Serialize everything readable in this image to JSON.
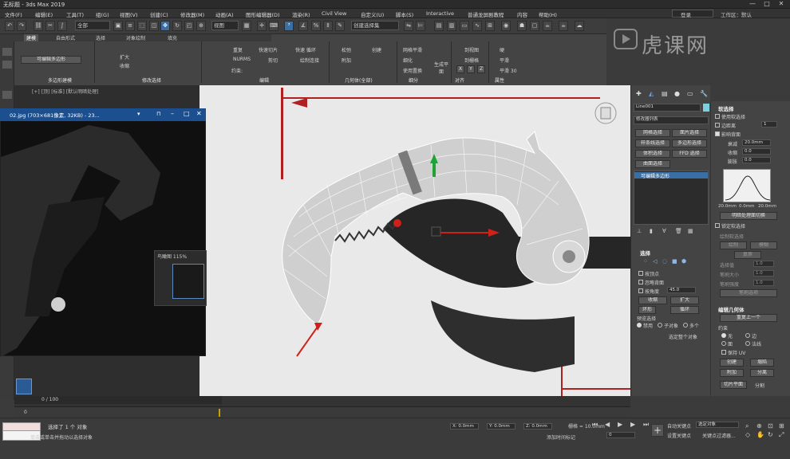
{
  "title_bar": {
    "title": "无标题 - 3ds Max 2019",
    "minimize": "—",
    "maximize": "□",
    "close": "✕"
  },
  "menu": [
    "文件(F)",
    "编辑(E)",
    "工具(T)",
    "组(G)",
    "视图(V)",
    "创建(C)",
    "修改器(M)",
    "动画(A)",
    "图形编辑器(D)",
    "渲染(R)",
    "Civil View",
    "自定义(U)",
    "脚本(S)",
    "Interactive",
    "普通龙屏剧教程",
    "内容",
    "帮助(H)"
  ],
  "account": {
    "sign_in": "登录",
    "workspace": "工作区：默认"
  },
  "toolbar": {
    "filter": "全部",
    "ref_coord": "视图",
    "named_sel": "创建选择集"
  },
  "ribbon": {
    "tabs": [
      "建模",
      "自由形式",
      "选择",
      "对象绘制",
      "填充"
    ],
    "sections": {
      "poly_modeling": "多边形建模",
      "modify_selection": "修改选择",
      "edit": "编辑",
      "geometry": "几何体(全部)",
      "subdivision": "细分",
      "align": "对齐",
      "properties": "属性"
    },
    "edit_items": [
      "重复",
      "快速切片",
      "快速 循环",
      "NURMS",
      "剪切",
      "绘制连接",
      "约束:"
    ],
    "geometry_items": [
      "松弛",
      "创建",
      "附加"
    ],
    "subdiv_items": [
      "网格平滑",
      "细化",
      "使用置换"
    ],
    "generate_plane": "生成平面",
    "align_items": [
      "到视图",
      "到栅格",
      "X",
      "Y",
      "Z"
    ],
    "prop_items": [
      "硬",
      "平滑",
      "平滑 30"
    ],
    "editable_poly": "可编辑多边形",
    "expand_items": [
      "扩大",
      "收缩"
    ]
  },
  "logo": "虎课网",
  "viewport": {
    "label": "[+] [顶] [标准] [默认明暗处理]"
  },
  "image_window": {
    "title": "02.jpg (703×681像素, 32KB) - 23...",
    "birdseye": "鸟瞰图 115%"
  },
  "command_panel": {
    "object_name": "Line001",
    "modifier_list": "修改器列表",
    "buttons": [
      "网格选择",
      "面片选择",
      "样条线选择",
      "多边形选择",
      "体积选择",
      "FFD 选择",
      "曲面选择"
    ],
    "stack_item": "可编辑多边形",
    "selection_header": "选择",
    "by_vertex": "按顶点",
    "ignore_backfacing": "忽略背面",
    "by_angle": "按角度",
    "angle_value": "45.0",
    "shrink": "收缩",
    "grow": "扩大",
    "ring": "环形",
    "loop": "循环",
    "preview_selection": "预览选择",
    "off": "禁用",
    "sub_object": "子对象",
    "multi": "多个",
    "selected_whole": "选定整个对象"
  },
  "soft_selection": {
    "header": "软选择",
    "use_soft": "使用软选择",
    "edge_distance": "边距离",
    "edge_value": "1",
    "affect_backfacing": "影响背面",
    "falloff": "衰减",
    "falloff_value": "20.0mm",
    "pinch": "收缩",
    "pinch_value": "0.0",
    "bubble": "膨胀",
    "bubble_value": "0.0",
    "curve_labels": [
      "20.0mm",
      "0.0mm",
      "20.0mm"
    ],
    "shaded_face_toggle": "明暗处理面切换",
    "lock_soft": "锁定软选择",
    "paint_soft": "绘制软选择",
    "paint": "绘制",
    "blur": "模糊",
    "revert": "复原",
    "select_value": "选择值",
    "select_value_v": "1.0",
    "brush_size": "笔刷大小",
    "brush_size_v": "1.0",
    "brush_strength": "笔刷强度",
    "brush_strength_v": "1.0",
    "brush_options": "笔刷选项"
  },
  "edit_geometry": {
    "header": "编辑几何体",
    "repeat_last": "重复上一个",
    "constraints": "约束",
    "none": "无",
    "edge": "边",
    "face": "面",
    "normal": "法线",
    "preserve_uvs": "保持 UV",
    "create": "创建",
    "collapse": "塌陷",
    "attach": "附加",
    "detach": "分离",
    "slice_plane": "切片平面",
    "split": "分割"
  },
  "timeline": {
    "frame": "0 / 100",
    "track_start": "0"
  },
  "status": {
    "selected": "选择了 1 个 对象",
    "hint": "单击或单击并拖动以选择对象",
    "x": "X: 0.0mm",
    "y": "Y: 0.0mm",
    "z": "Z: 0.0mm",
    "grid": "栅格 = 10.0mm",
    "add_time_tag": "添加时间标记",
    "auto_key": "自动关键点",
    "set_key": "设置关键点",
    "selected_obj": "选定对象",
    "key_filters": "关键点过滤器...",
    "frame_value": "0"
  },
  "colors": {
    "accent_blue": "#3a6fa5",
    "title_blue": "#1b4f8f",
    "red_arrow": "#d0201a",
    "mesh_gray": "#c8c8c8",
    "gizmo_green": "#1fa336"
  }
}
